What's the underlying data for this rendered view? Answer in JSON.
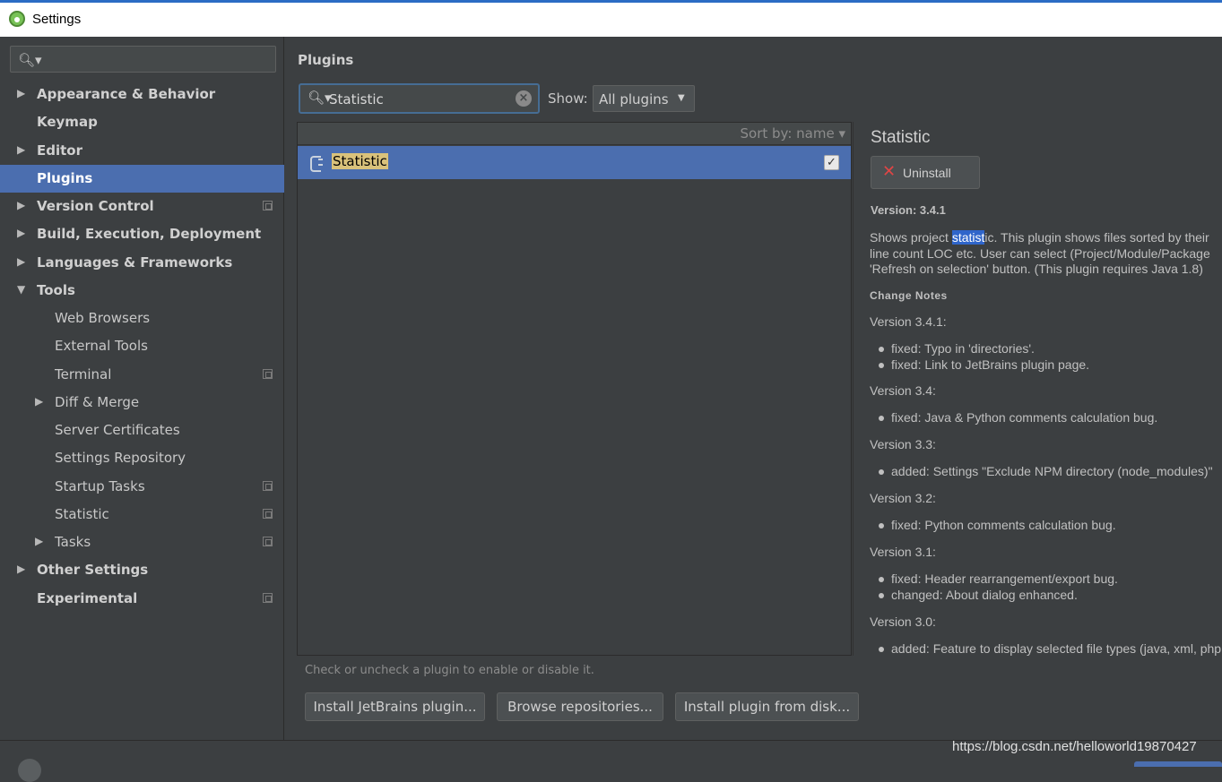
{
  "window": {
    "title": "Settings"
  },
  "sidebar": {
    "search_placeholder": "",
    "items": [
      {
        "label": "Appearance & Behavior",
        "level": 0,
        "arrow": "▶",
        "bold": true,
        "copy": false
      },
      {
        "label": "Keymap",
        "level": 0,
        "arrow": "",
        "bold": true,
        "copy": false
      },
      {
        "label": "Editor",
        "level": 0,
        "arrow": "▶",
        "bold": true,
        "copy": false
      },
      {
        "label": "Plugins",
        "level": 0,
        "arrow": "",
        "bold": true,
        "copy": false,
        "selected": true
      },
      {
        "label": "Version Control",
        "level": 0,
        "arrow": "▶",
        "bold": true,
        "copy": true
      },
      {
        "label": "Build, Execution, Deployment",
        "level": 0,
        "arrow": "▶",
        "bold": true,
        "copy": false
      },
      {
        "label": "Languages & Frameworks",
        "level": 0,
        "arrow": "▶",
        "bold": true,
        "copy": false
      },
      {
        "label": "Tools",
        "level": 0,
        "arrow": "▼",
        "bold": true,
        "copy": false
      },
      {
        "label": "Web Browsers",
        "level": 1,
        "arrow": "",
        "bold": false,
        "copy": false
      },
      {
        "label": "External Tools",
        "level": 1,
        "arrow": "",
        "bold": false,
        "copy": false
      },
      {
        "label": "Terminal",
        "level": 1,
        "arrow": "",
        "bold": false,
        "copy": true
      },
      {
        "label": "Diff & Merge",
        "level": 1,
        "arrow": "▶",
        "bold": false,
        "copy": false
      },
      {
        "label": "Server Certificates",
        "level": 1,
        "arrow": "",
        "bold": false,
        "copy": false
      },
      {
        "label": "Settings Repository",
        "level": 1,
        "arrow": "",
        "bold": false,
        "copy": false
      },
      {
        "label": "Startup Tasks",
        "level": 1,
        "arrow": "",
        "bold": false,
        "copy": true
      },
      {
        "label": "Statistic",
        "level": 1,
        "arrow": "",
        "bold": false,
        "copy": true
      },
      {
        "label": "Tasks",
        "level": 1,
        "arrow": "▶",
        "bold": false,
        "copy": true
      },
      {
        "label": "Other Settings",
        "level": 0,
        "arrow": "▶",
        "bold": true,
        "copy": false
      },
      {
        "label": "Experimental",
        "level": 0,
        "arrow": "",
        "bold": true,
        "copy": true
      }
    ]
  },
  "main": {
    "title": "Plugins",
    "search_value": "Statistic",
    "show_label": "Show:",
    "show_value": "All plugins",
    "sort_label": "Sort by: name ▾",
    "plugins": [
      {
        "name": "Statistic",
        "enabled": true
      }
    ],
    "hint": "Check or uncheck a plugin to enable or disable it.",
    "buttons": {
      "install_jetbrains": "Install JetBrains plugin...",
      "browse": "Browse repositories...",
      "install_disk": "Install plugin from disk..."
    }
  },
  "details": {
    "name": "Statistic",
    "uninstall_label": "Uninstall",
    "version": "Version: 3.4.1",
    "description": {
      "line1_pre": "Shows project ",
      "line1_hl": "statist",
      "line1_post": "ic. This plugin shows files sorted by their",
      "line2": "line count LOC etc. User can select (Project/Module/Package",
      "line3": "'Refresh on selection' button. (This plugin requires Java 1.8)"
    },
    "change_notes_title": "Change Notes",
    "changes": [
      {
        "version": "Version 3.4.1:",
        "items": [
          "fixed: Typo in 'directories'.",
          "fixed: Link to JetBrains plugin page."
        ]
      },
      {
        "version": "Version 3.4:",
        "items": [
          "fixed: Java & Python comments calculation bug."
        ]
      },
      {
        "version": "Version 3.3:",
        "items": [
          "added: Settings \"Exclude NPM directory (node_modules)\""
        ]
      },
      {
        "version": "Version 3.2:",
        "items": [
          "fixed: Python comments calculation bug."
        ]
      },
      {
        "version": "Version 3.1:",
        "items": [
          "fixed: Header rearrangement/export bug.",
          "changed: About dialog enhanced."
        ]
      },
      {
        "version": "Version 3.0:",
        "items": [
          "added: Feature to display selected file types (java, xml, php"
        ]
      }
    ]
  },
  "watermark": "https://blog.csdn.net/helloworld19870427",
  "colors": {
    "selection": "#4b6eaf",
    "highlight": "#d9c27b",
    "uninstall_x": "#e04545"
  }
}
